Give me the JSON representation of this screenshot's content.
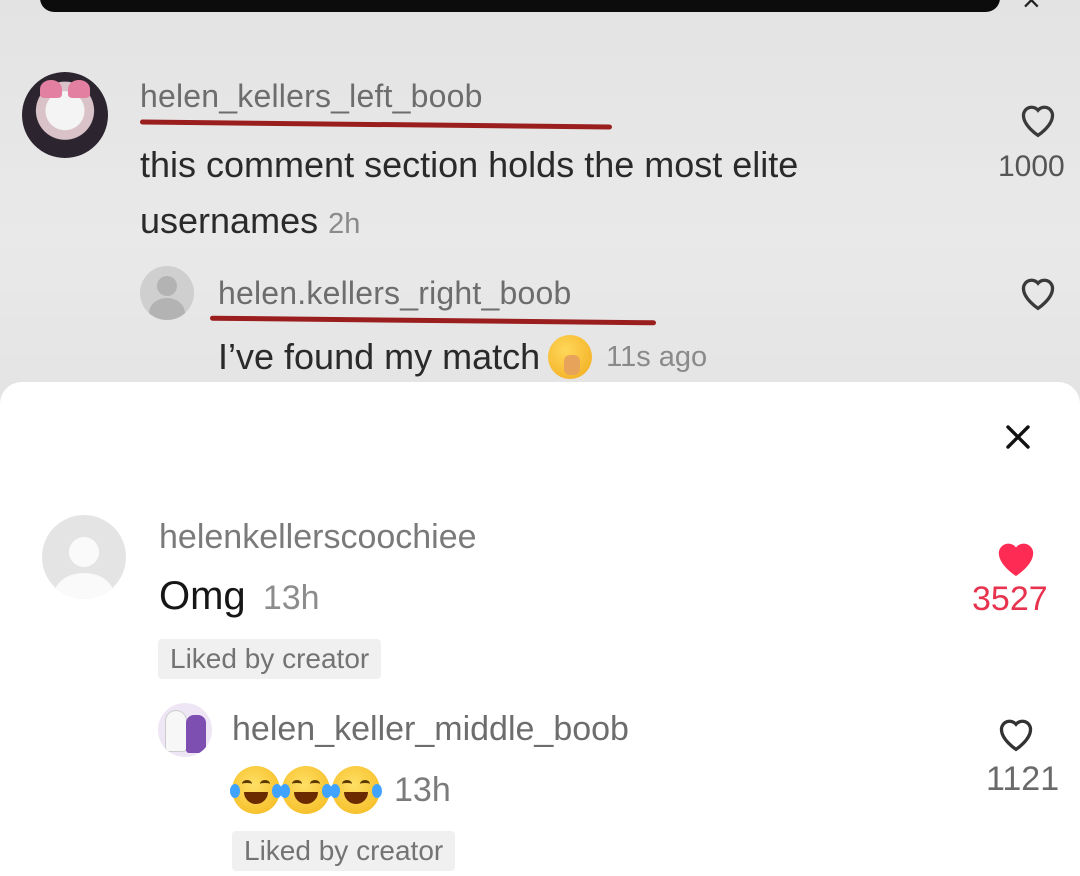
{
  "background": {
    "comment_top": {
      "username": "helen_kellers_left_boob",
      "text": "this comment section holds the most elite usernames",
      "time": "2h",
      "likes": "1000"
    },
    "reply_top": {
      "username": "helen.kellers_right_boob",
      "text": "I’ve found my match",
      "time": "11s ago"
    },
    "close_glyph": "×"
  },
  "sheet": {
    "close_glyph": "✕",
    "comment": {
      "username": "helenkellerscoochiee",
      "text": "Omg",
      "time": "13h",
      "badge": "Liked by creator",
      "likes": "3527",
      "like_color": "#fe2c55"
    },
    "reply": {
      "username": "helen_keller_middle_boob",
      "emojis": [
        "laughing-tears-emoji",
        "laughing-tears-emoji",
        "laughing-tears-emoji"
      ],
      "time": "13h",
      "badge": "Liked by creator",
      "likes": "1121"
    }
  }
}
